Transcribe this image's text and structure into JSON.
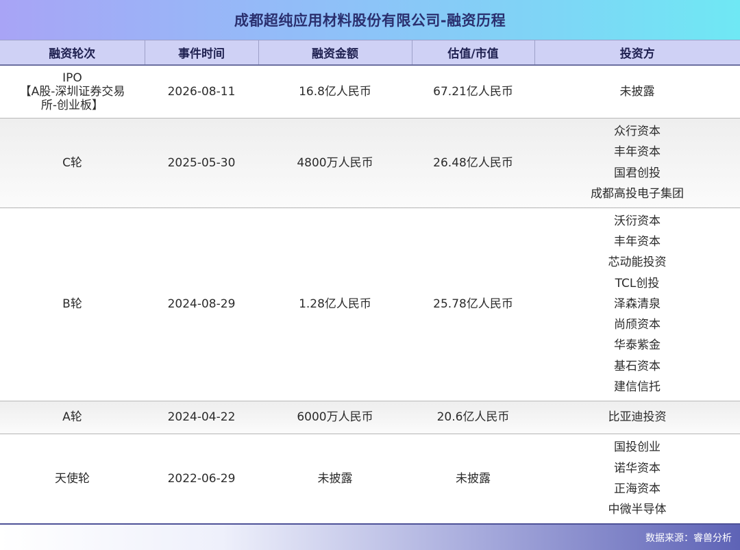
{
  "title": "成都超纯应用材料股份有限公司-融资历程",
  "columns": [
    "融资轮次",
    "事件时间",
    "融资金额",
    "估值/市值",
    "投资方"
  ],
  "rows": [
    {
      "round_lines": [
        "IPO",
        "【A股-深圳证券交易",
        "所-创业板】"
      ],
      "date": "2026-08-11",
      "amount": "16.8亿人民币",
      "valuation": "67.21亿人民币",
      "investors": [
        "未披露"
      ]
    },
    {
      "round": "C轮",
      "date": "2025-05-30",
      "amount": "4800万人民币",
      "valuation": "26.48亿人民币",
      "investors": [
        "众行资本",
        "丰年资本",
        "国君创投",
        "成都高投电子集团"
      ]
    },
    {
      "round": "B轮",
      "date": "2024-08-29",
      "amount": "1.28亿人民币",
      "valuation": "25.78亿人民币",
      "investors": [
        "沃衍资本",
        "丰年资本",
        "芯动能投资",
        "TCL创投",
        "泽森清泉",
        "尚颀资本",
        "华泰紫金",
        "基石资本",
        "建信信托"
      ]
    },
    {
      "round": "A轮",
      "date": "2024-04-22",
      "amount": "6000万人民币",
      "valuation": "20.6亿人民币",
      "investors": [
        "比亚迪投资"
      ]
    },
    {
      "round": "天使轮",
      "date": "2022-06-29",
      "amount": "未披露",
      "valuation": "未披露",
      "investors": [
        "国投创业",
        "诺华资本",
        "正海资本",
        "中微半导体"
      ]
    }
  ],
  "footer": "数据来源：睿兽分析"
}
